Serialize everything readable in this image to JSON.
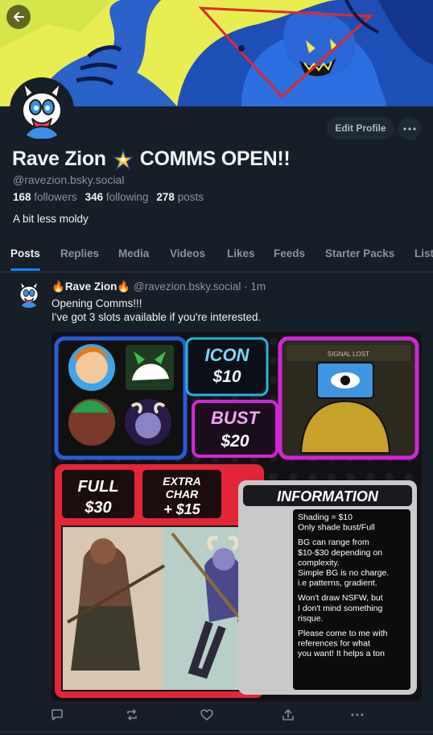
{
  "profile": {
    "display_name": "Rave Zion",
    "name_suffix": "COMMS OPEN!!",
    "handle": "@ravezion.bsky.social",
    "followers_count": "168",
    "followers_label": "followers",
    "following_count": "346",
    "following_label": "following",
    "posts_count": "278",
    "posts_label": "posts",
    "bio": "A bit less moldy",
    "edit_profile_label": "Edit Profile"
  },
  "tabs": [
    {
      "label": "Posts",
      "active": true
    },
    {
      "label": "Replies"
    },
    {
      "label": "Media"
    },
    {
      "label": "Videos"
    },
    {
      "label": "Likes"
    },
    {
      "label": "Feeds"
    },
    {
      "label": "Starter Packs"
    },
    {
      "label": "Lists"
    }
  ],
  "post": {
    "author": "Rave Zion",
    "handle": "@ravezion.bsky.social",
    "time": "1m",
    "line1": "Opening Comms!!!",
    "line2": "I've got 3 slots available if you're interested."
  },
  "commission_sheet": {
    "icon_label": "ICON",
    "icon_price": "$10",
    "bust_label": "BUST",
    "bust_price": "$20",
    "full_label": "FULL",
    "full_price": "$30",
    "extra_label_1": "EXTRA",
    "extra_label_2": "CHAR",
    "extra_price": "+ $15",
    "info_title": "INFORMATION",
    "signal_lost": "SIGNAL LOST",
    "info_lines": [
      "Shading = $10",
      "Only shade bust/Full",
      "",
      "BG can range from",
      "$10-$30 depending on",
      "complexity.",
      "Simple BG is no charge.",
      "i.e patterns, gradient.",
      "",
      "Won't draw NSFW, but",
      "I don't mind something",
      "risque.",
      "",
      "Please come to me with",
      "references for what",
      "you want! It helps a ton"
    ]
  },
  "icons": {
    "back": "arrow-left-icon",
    "more": "ellipsis-icon",
    "star": "star-badge-icon",
    "fire": "fire-emoji-icon",
    "reply": "reply-icon",
    "repost": "repost-icon",
    "like": "heart-icon",
    "share": "share-icon",
    "post_more": "ellipsis-icon"
  },
  "colors": {
    "background": "#161e27",
    "accent": "#1185fe",
    "muted": "#8795a6",
    "sheet_blue": "#2a5bd8",
    "sheet_pink": "#d126d6",
    "sheet_red": "#e32636"
  }
}
